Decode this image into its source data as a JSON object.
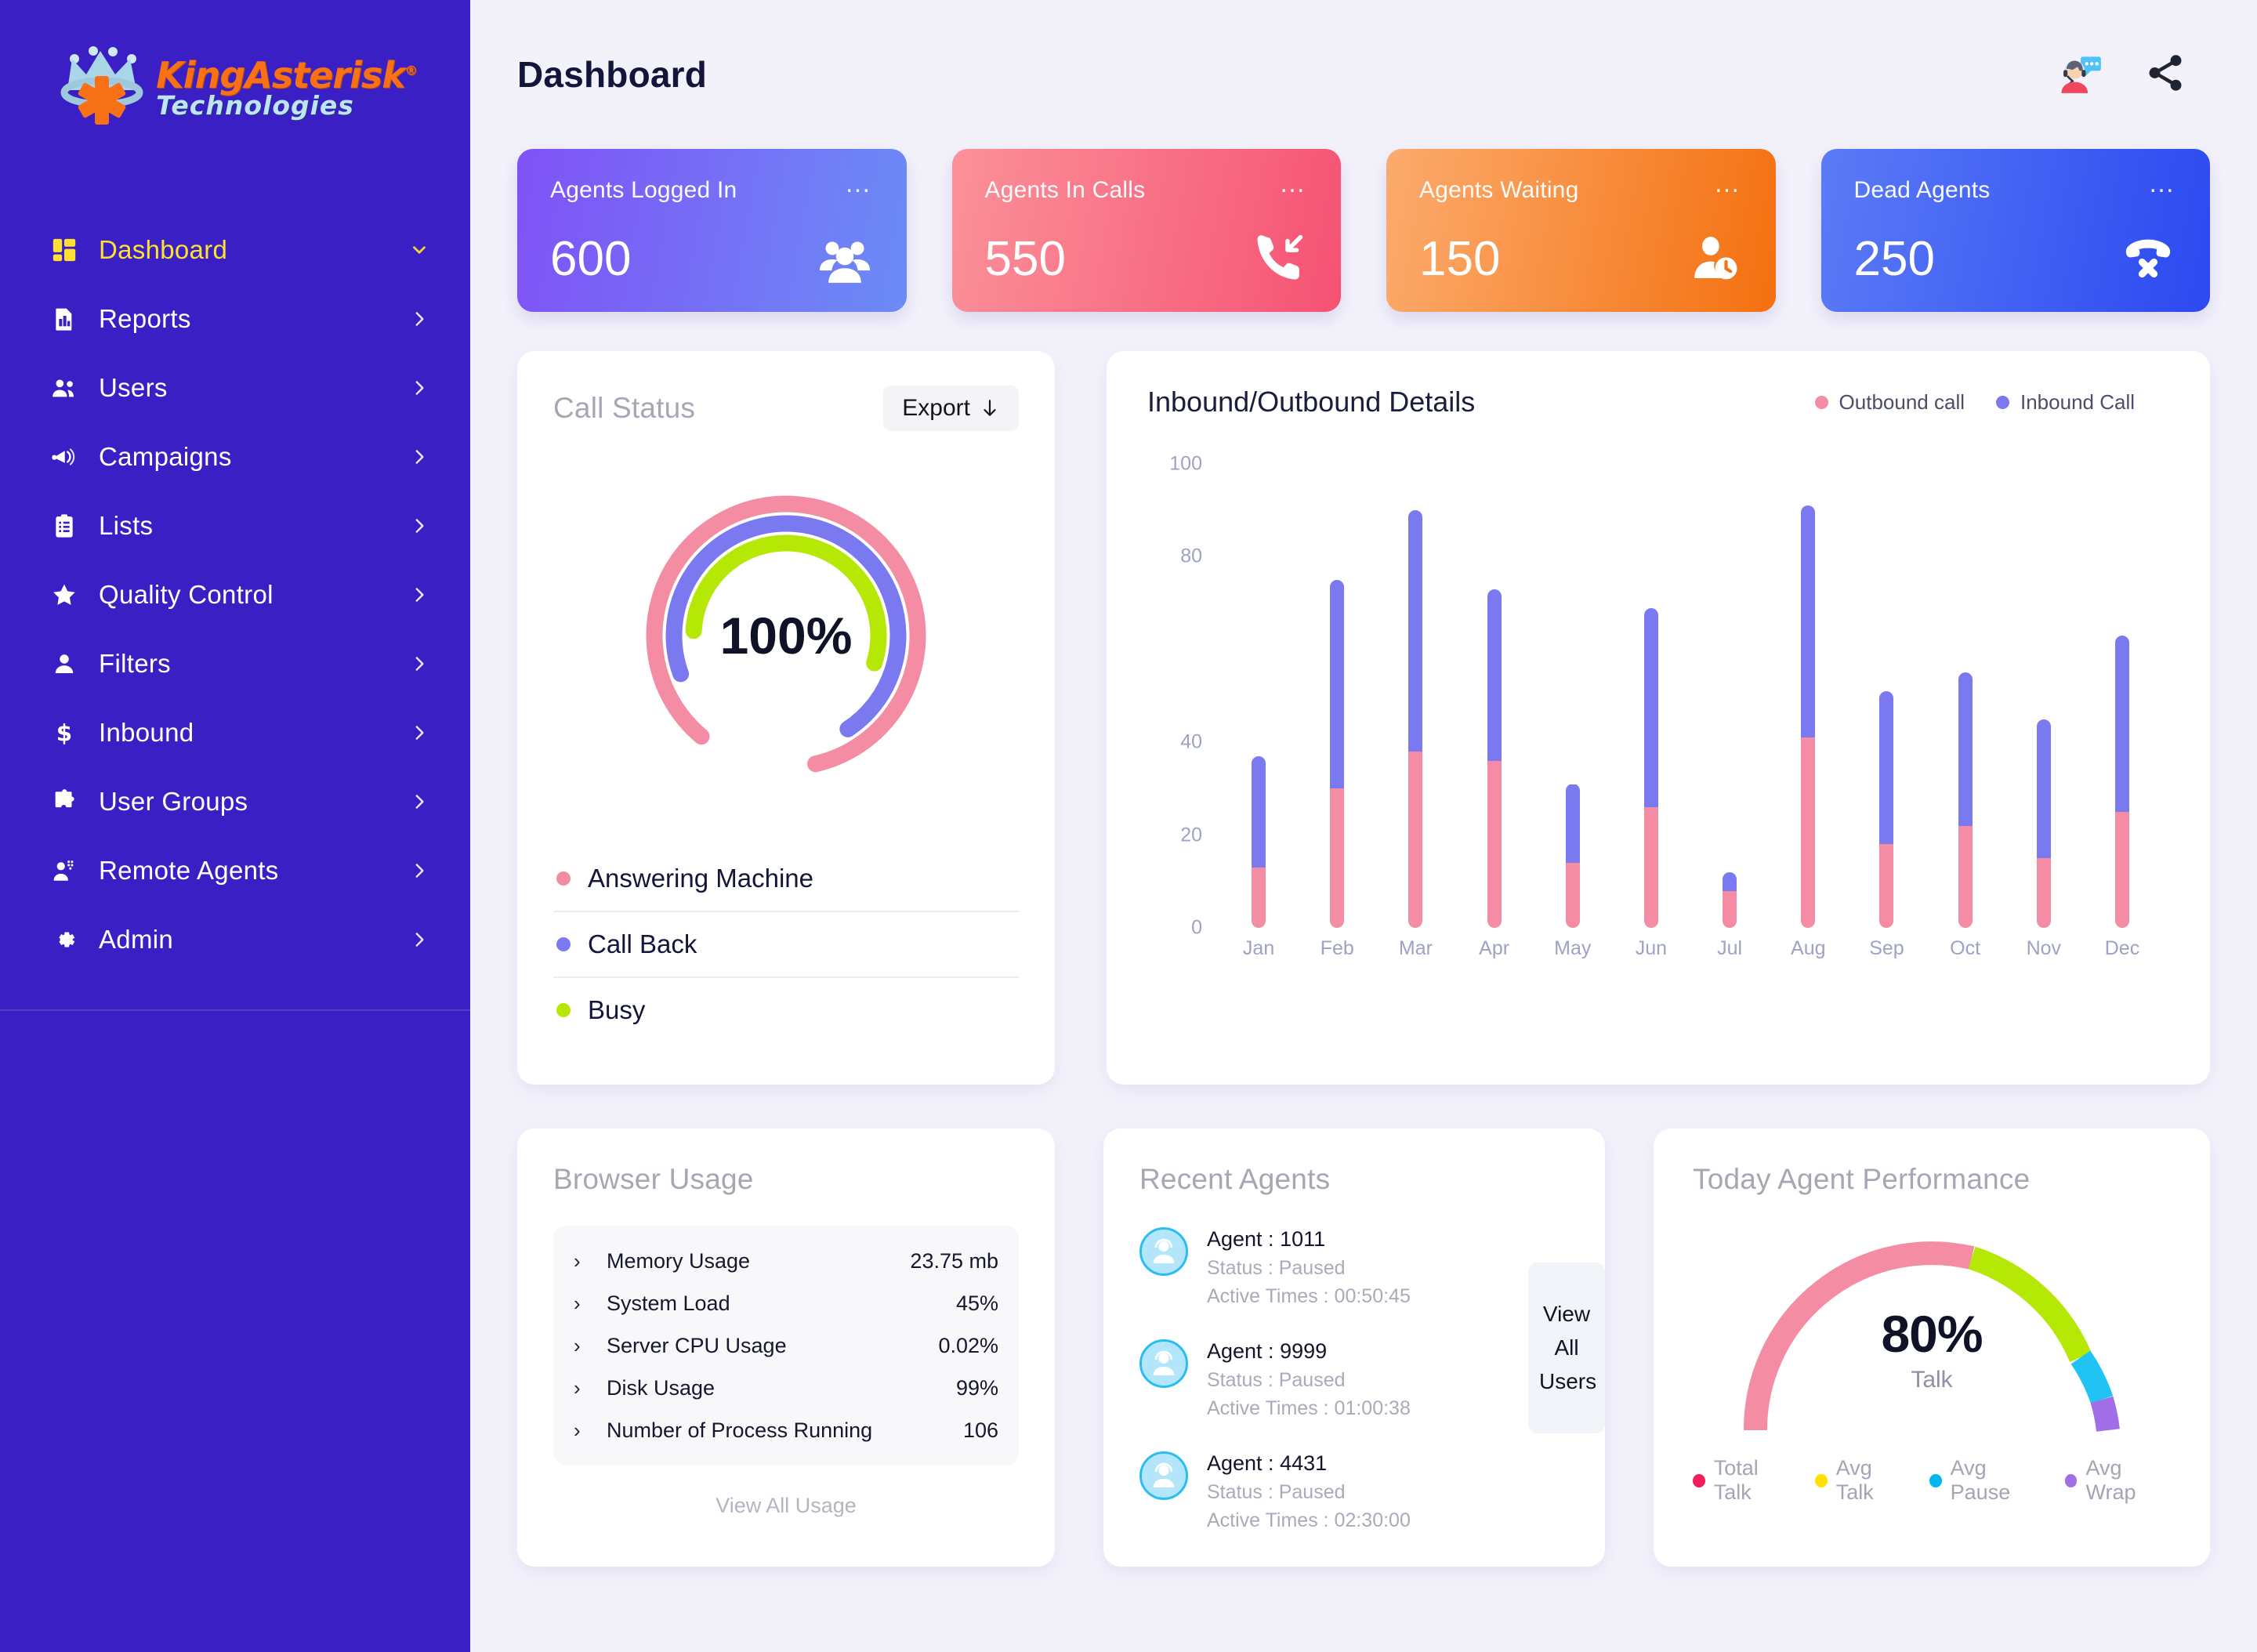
{
  "brand": {
    "name_primary": "KingAsterisk",
    "registered": "®",
    "name_secondary": "Technologies"
  },
  "sidebar": {
    "items": [
      {
        "label": "Dashboard",
        "icon": "grid-icon",
        "chevron": "chevron-down-icon",
        "active": true
      },
      {
        "label": "Reports",
        "icon": "report-chart-icon",
        "chevron": "chevron-right-icon",
        "active": false
      },
      {
        "label": "Users",
        "icon": "users-icon",
        "chevron": "chevron-right-icon",
        "active": false
      },
      {
        "label": "Campaigns",
        "icon": "megaphone-icon",
        "chevron": "chevron-right-icon",
        "active": false
      },
      {
        "label": "Lists",
        "icon": "clipboard-list-icon",
        "chevron": "chevron-right-icon",
        "active": false
      },
      {
        "label": "Quality Control",
        "icon": "star-icon",
        "chevron": "chevron-right-icon",
        "active": false
      },
      {
        "label": "Filters",
        "icon": "person-icon",
        "chevron": "chevron-right-icon",
        "active": false
      },
      {
        "label": "Inbound",
        "icon": "dollar-icon",
        "chevron": "chevron-right-icon",
        "active": false
      },
      {
        "label": "User Groups",
        "icon": "puzzle-icon",
        "chevron": "chevron-right-icon",
        "active": false
      },
      {
        "label": "Remote Agents",
        "icon": "headset-agent-icon",
        "chevron": "chevron-right-icon",
        "active": false
      },
      {
        "label": "Admin",
        "icon": "gear-icon",
        "chevron": "chevron-right-icon",
        "active": false
      }
    ]
  },
  "header": {
    "title": "Dashboard",
    "icons": [
      "support-agent-icon",
      "share-icon"
    ]
  },
  "stats": [
    {
      "title": "Agents Logged In",
      "value": "600",
      "icon": "users-group-icon",
      "menu": "…",
      "theme": "c-blue"
    },
    {
      "title": "Agents In Calls",
      "value": "550",
      "icon": "call-incoming-icon",
      "menu": "…",
      "theme": "c-pink"
    },
    {
      "title": "Agents Waiting",
      "value": "150",
      "icon": "user-clock-icon",
      "menu": "…",
      "theme": "c-orange"
    },
    {
      "title": "Dead Agents",
      "value": "250",
      "icon": "phone-x-icon",
      "menu": "…",
      "theme": "c-indigo"
    }
  ],
  "call_status": {
    "title": "Call Status",
    "export_label": "Export",
    "export_icon": "download-arrow-icon",
    "percent": "100%",
    "legend": [
      {
        "label": "Answering Machine",
        "color": "#f48da3"
      },
      {
        "label": "Call Back",
        "color": "#7b79f0"
      },
      {
        "label": "Busy",
        "color": "#b6e806"
      }
    ]
  },
  "chart_data": {
    "type": "bar",
    "title": "Inbound/Outbound Details",
    "stacked": true,
    "xlabel": "",
    "ylabel": "",
    "ylim": [
      0,
      100
    ],
    "yticks": [
      0,
      20,
      40,
      80,
      100
    ],
    "grid": false,
    "legend_position": "top-right",
    "categories": [
      "Jan",
      "Feb",
      "Mar",
      "Apr",
      "May",
      "Jun",
      "Jul",
      "Aug",
      "Sep",
      "Oct",
      "Nov",
      "Dec"
    ],
    "series": [
      {
        "name": "Outbound call",
        "color": "#f48da3",
        "values": [
          13,
          30,
          38,
          36,
          14,
          26,
          8,
          41,
          18,
          22,
          15,
          25
        ]
      },
      {
        "name": "Inbound Call",
        "color": "#7b79f0",
        "values": [
          24,
          45,
          52,
          37,
          17,
          43,
          4,
          50,
          33,
          33,
          30,
          38
        ]
      }
    ],
    "totals": [
      37,
      75,
      90,
      73,
      31,
      69,
      12,
      91,
      51,
      55,
      45,
      63
    ]
  },
  "browser_usage": {
    "title": "Browser Usage",
    "rows": [
      {
        "label": "Memory Usage",
        "value": "23.75 mb"
      },
      {
        "label": "System Load",
        "value": "45%"
      },
      {
        "label": "Server CPU Usage",
        "value": "0.02%"
      },
      {
        "label": "Disk Usage",
        "value": "99%"
      },
      {
        "label": "Number of Process Running",
        "value": "106"
      }
    ],
    "footer_link": "View All Usage"
  },
  "recent_agents": {
    "title": "Recent Agents",
    "view_all_label": "View All Users",
    "agents": [
      {
        "name": "Agent : 1011",
        "status": "Status : Paused",
        "active_times": "Active Times : 00:50:45"
      },
      {
        "name": "Agent : 9999",
        "status": "Status : Paused",
        "active_times": "Active Times : 01:00:38"
      },
      {
        "name": "Agent : 4431",
        "status": "Status : Paused",
        "active_times": "Active Times : 02:30:00"
      }
    ]
  },
  "agent_performance": {
    "title": "Today Agent Performance",
    "percent": "80%",
    "sub_label": "Talk",
    "segments": [
      {
        "label": "Total Talk",
        "color": "#f48da3",
        "dot_color": "#f31d5b",
        "share": 56
      },
      {
        "label": "Avg Talk",
        "color": "#b6e806",
        "dot_color": "#ffe000",
        "share": 24
      },
      {
        "label": "Avg Pause",
        "color": "#20c3f4",
        "dot_color": "#00b6f0",
        "share": 12
      },
      {
        "label": "Avg Wrap",
        "color": "#a26ee8",
        "dot_color": "#a26ee8",
        "share": 8
      }
    ]
  }
}
